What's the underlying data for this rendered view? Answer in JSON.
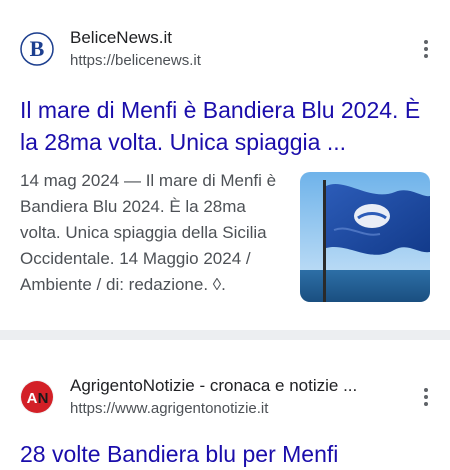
{
  "results": [
    {
      "site_name": "BeliceNews.it",
      "url": "https://belicenews.it",
      "favicon_letter": "B",
      "favicon_color": "#1d3f8f",
      "title": "Il mare di Menfi è Bandiera Blu 2024. È la 28ma volta. Unica spiaggia ...",
      "snippet_date": "14 mag 2024 — ",
      "snippet_text": "Il mare di Menfi è Bandiera Blu 2024. È la 28ma volta. Unica spiaggia della Sicilia Occidentale. 14 Maggio 2024 / Ambiente / di: redazione. ◊.",
      "thumbnail": "flag-photo"
    },
    {
      "site_name": "AgrigentoNotizie - cronaca e notizie ...",
      "url": "https://www.agrigentonotizie.it",
      "favicon_letters": [
        "A",
        "N"
      ],
      "favicon_color": "#d32027",
      "title": "28 volte Bandiera blu per Menfi"
    }
  ],
  "colors": {
    "title_link": "#1a0dab",
    "snippet": "#4d5156",
    "separator": "#eceef1"
  },
  "icons": [
    "kebab-menu-icon"
  ]
}
